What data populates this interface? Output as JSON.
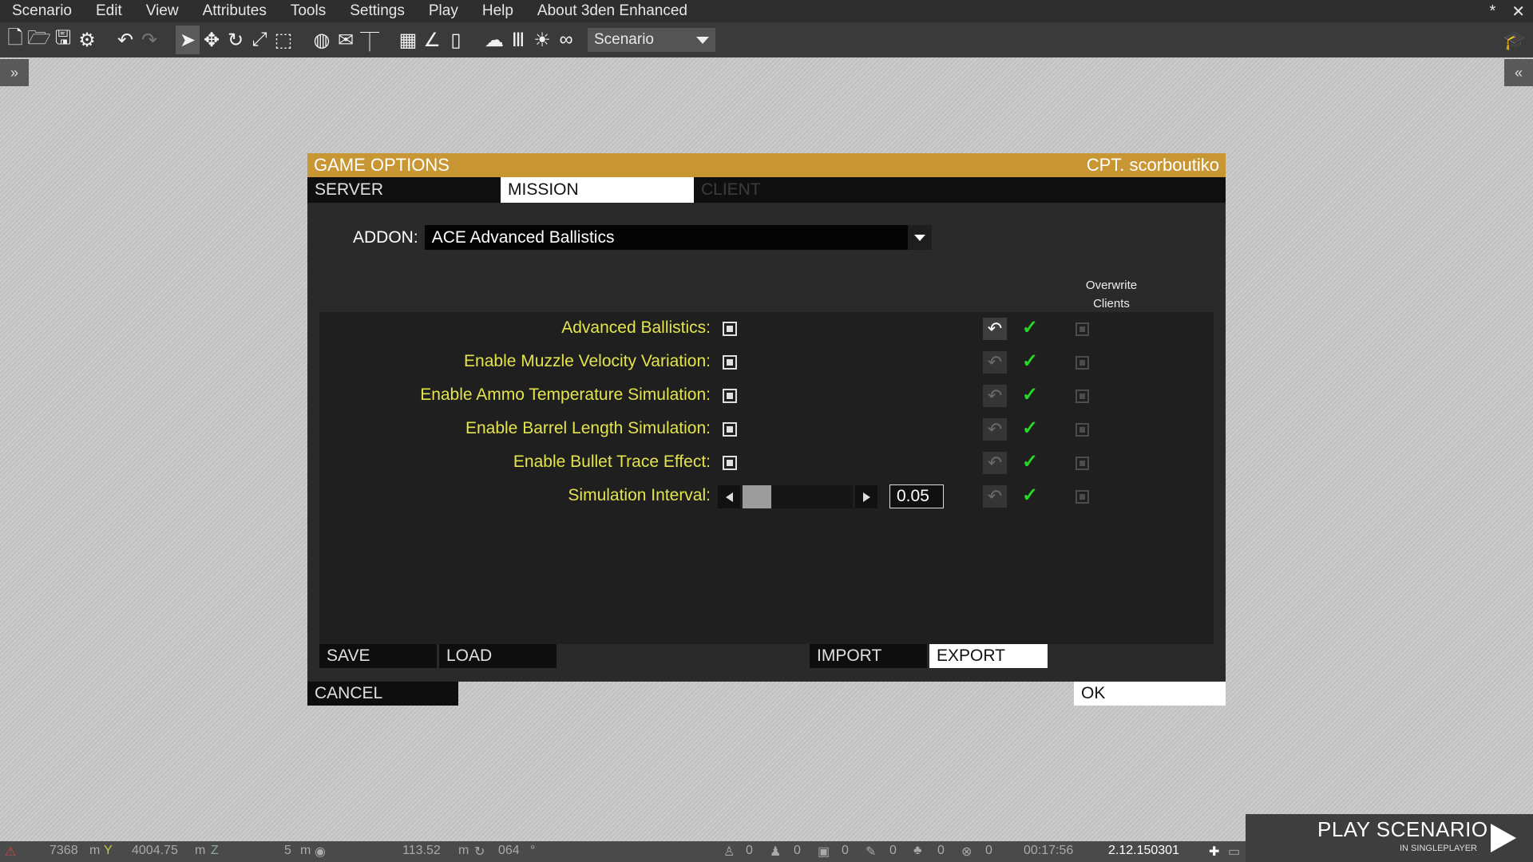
{
  "menu": [
    "Scenario",
    "Edit",
    "View",
    "Attributes",
    "Tools",
    "Settings",
    "Play",
    "Help",
    "About 3den Enhanced"
  ],
  "window_controls": {
    "star": "*",
    "close": "✕"
  },
  "toolbar": {
    "mode_combo": "Scenario",
    "icons": [
      "new-file-icon",
      "open-folder-icon",
      "save-icon",
      "steam-icon",
      "undo-icon",
      "redo-icon",
      "select-icon",
      "translate-icon",
      "rotate-icon",
      "scale-icon",
      "area-icon",
      "globe-icon",
      "mail-icon",
      "vertical-icon",
      "grid-icon",
      "angle-icon",
      "stack-icon",
      "weather-icon",
      "library-icon",
      "sun-icon",
      "binoculars-icon"
    ]
  },
  "side_toggles": {
    "left": "»",
    "right": "«"
  },
  "dialog": {
    "title": "GAME OPTIONS",
    "user": "CPT. scorboutiko",
    "tabs": [
      {
        "label": "SERVER",
        "state": "normal"
      },
      {
        "label": "MISSION",
        "state": "active"
      },
      {
        "label": "CLIENT",
        "state": "disabled"
      }
    ],
    "addon_label": "ADDON:",
    "addon_value": "ACE Advanced Ballistics",
    "overwrite_header_line1": "Overwrite",
    "overwrite_header_line2": "Clients",
    "settings": [
      {
        "label": "Advanced Ballistics:",
        "control": "checkbox",
        "reset_active": true
      },
      {
        "label": "Enable Muzzle Velocity Variation:",
        "control": "checkbox",
        "reset_active": false
      },
      {
        "label": "Enable Ammo Temperature Simulation:",
        "control": "checkbox",
        "reset_active": false
      },
      {
        "label": "Enable Barrel Length Simulation:",
        "control": "checkbox",
        "reset_active": false
      },
      {
        "label": "Enable Bullet Trace Effect:",
        "control": "checkbox",
        "reset_active": false
      },
      {
        "label": "Simulation Interval:",
        "control": "slider",
        "value": "0.05",
        "slider_fraction": 0.26,
        "reset_active": false
      }
    ],
    "buttons": {
      "save": "SAVE",
      "load": "LOAD",
      "import": "IMPORT",
      "export": "EXPORT",
      "cancel": "CANCEL",
      "ok": "OK"
    }
  },
  "statusbar": {
    "x": "7368",
    "x_unit": "m",
    "y": "4004.75",
    "y_unit": "m",
    "grid": "5",
    "grid_unit": "m",
    "distance": "113.52",
    "distance_unit": "m",
    "rotation": "064",
    "rotation_unit": "°",
    "counts": [
      "0",
      "0",
      "0",
      "0",
      "0",
      "0"
    ],
    "time": "00:17:56",
    "version": "2.12.150301"
  },
  "play": {
    "title": "PLAY SCENARIO",
    "subtitle": "IN SINGLEPLAYER"
  },
  "colors": {
    "accent": "#c89632",
    "setting_label": "#e4e44d",
    "check": "#26d926"
  }
}
